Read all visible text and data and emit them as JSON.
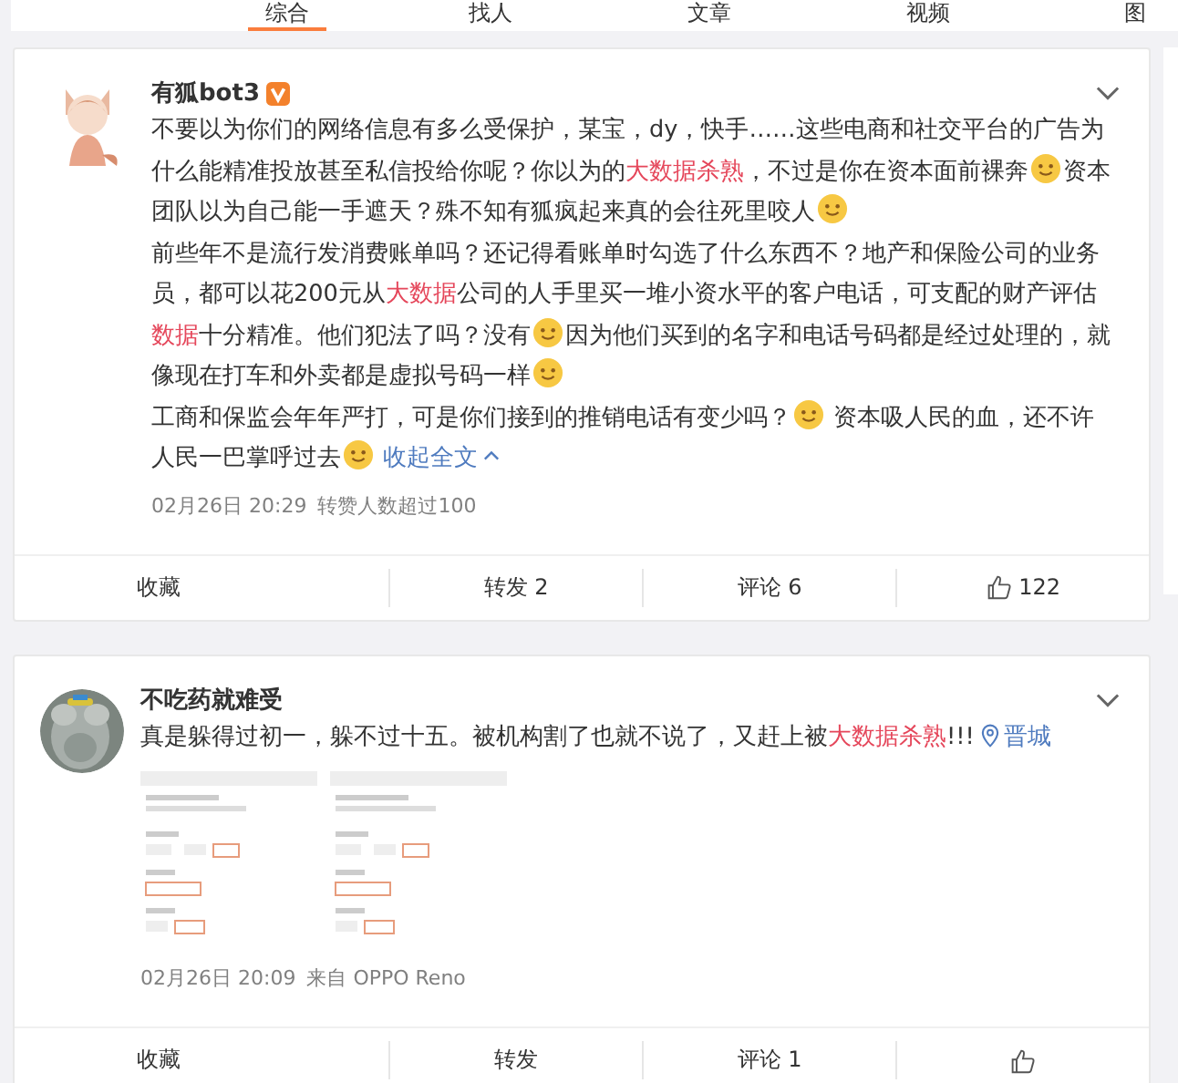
{
  "tabs": [
    {
      "label": "综合",
      "selected": true
    },
    {
      "label": "找人",
      "selected": false
    },
    {
      "label": "文章",
      "selected": false
    },
    {
      "label": "视频",
      "selected": false
    },
    {
      "label": "图",
      "selected": false
    }
  ],
  "posts": [
    {
      "author": "有狐bot3",
      "verified": true,
      "avatar": {
        "kind": "drawing"
      },
      "paragraphs": [
        [
          {
            "kind": "text",
            "text": "不要以为你们的网络信息有多么受保护，某宝，dy，快手……这些电商和社交平台的广告为什么能精准投放甚至私信投给你呢？你以为的"
          },
          {
            "kind": "link",
            "text": "大数据杀熟"
          },
          {
            "kind": "text",
            "text": "，不过是你在资本面前裸奔"
          },
          {
            "kind": "emoji"
          },
          {
            "kind": "text",
            "text": "资本团队以为自己能一手遮天？殊不知有狐疯起来真的会往死里咬人"
          },
          {
            "kind": "emoji"
          }
        ],
        [
          {
            "kind": "text",
            "text": "前些年不是流行发消费账单吗？还记得看账单时勾选了什么东西不？地产和保险公司的业务员，都可以花200元从"
          },
          {
            "kind": "link",
            "text": "大数据"
          },
          {
            "kind": "text",
            "text": "公司的人手里买一堆小资水平的客户电话，可支配的财产评估"
          },
          {
            "kind": "link",
            "text": "数据"
          },
          {
            "kind": "text",
            "text": "十分精准。他们犯法了吗？没有"
          },
          {
            "kind": "emoji"
          },
          {
            "kind": "text",
            "text": "因为他们买到的名字和电话号码都是经过处理的，就像现在打车和外卖都是虚拟号码一样"
          },
          {
            "kind": "emoji"
          }
        ],
        [
          {
            "kind": "text",
            "text": "工商和保监会年年严打，可是你们接到的推销电话有变少吗？"
          },
          {
            "kind": "emoji"
          },
          {
            "kind": "text",
            "text": " 资本吸人民的血，还不许人民一巴掌呼过去"
          },
          {
            "kind": "emoji"
          }
        ]
      ],
      "collapse_link": "收起全文",
      "time": "02月26日 20:29",
      "note": "转赞人数超过100",
      "actions": {
        "favorite": "收藏",
        "repost": "转发 2",
        "comment": "评论 6",
        "likes": "122"
      }
    },
    {
      "author": "不吃药就难受",
      "verified": false,
      "avatar": {
        "kind": "picture"
      },
      "paragraphs": [
        [
          {
            "kind": "text",
            "text": "真是躲得过初一，躲不过十五。被机构割了也就不说了，又赶上被"
          },
          {
            "kind": "link",
            "text": "大数据杀熟"
          },
          {
            "kind": "text",
            "text": "!!! "
          },
          {
            "kind": "location",
            "text": "晋城"
          }
        ]
      ],
      "images": [
        {
          "kind": "picture"
        },
        {
          "kind": "picture"
        }
      ],
      "time": "02月26日 20:09",
      "source": "来自 OPPO Reno",
      "actions": {
        "favorite": "收藏",
        "repost": "转发",
        "comment": "评论 1"
      }
    }
  ]
}
